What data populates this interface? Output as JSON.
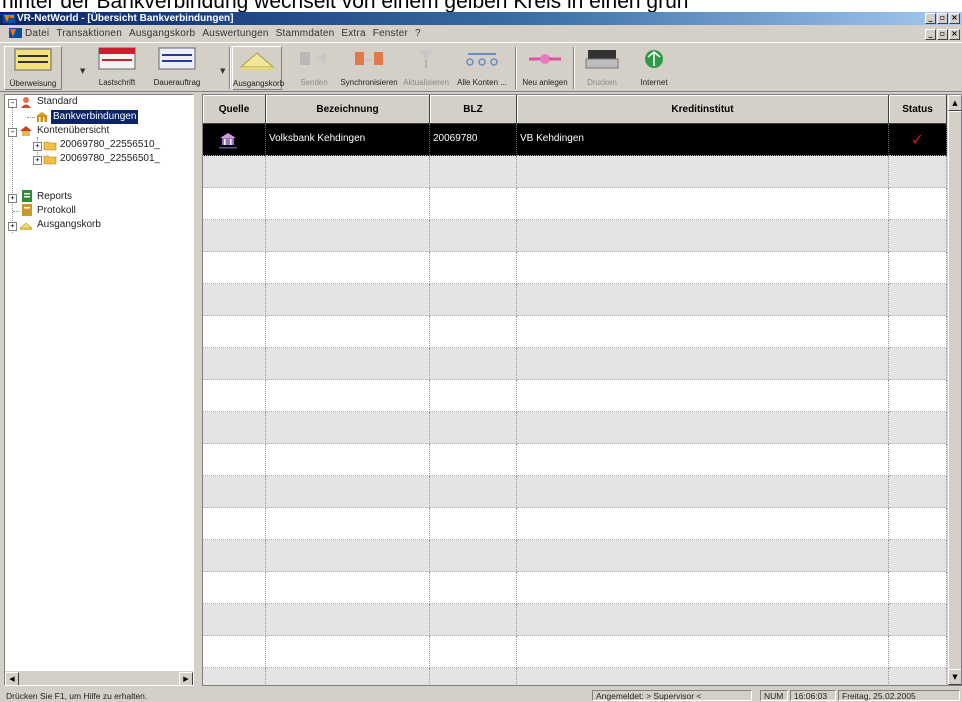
{
  "caption_text": "hinter der Bankverbindung wechselt von einem gelben Kreis in einen grün",
  "window": {
    "title": "VR-NetWorld - [Übersicht Bankverbindungen]"
  },
  "menu": [
    "Datei",
    "Transaktionen",
    "Ausgangskorb",
    "Auswertungen",
    "Stammdaten",
    "Extra",
    "Fenster",
    "?"
  ],
  "toolbar": [
    {
      "label": "Überweisung",
      "icon": "transfer-form-icon",
      "enabled": true
    },
    {
      "label": "Lastschrift",
      "icon": "debit-form-icon",
      "enabled": true
    },
    {
      "label": "Dauerauftrag",
      "icon": "standing-order-icon",
      "enabled": true
    },
    {
      "label": "Ausgangskorb",
      "icon": "outbox-icon",
      "enabled": true
    },
    {
      "label": "Senden",
      "icon": "send-icon",
      "enabled": false
    },
    {
      "label": "Synchronisieren",
      "icon": "synchronize-icon",
      "enabled": true
    },
    {
      "label": "Aktualisieren",
      "icon": "refresh-icon",
      "enabled": false
    },
    {
      "label": "Alle Konten ...",
      "icon": "all-accounts-icon",
      "enabled": true
    },
    {
      "label": "Neu anlegen",
      "icon": "new-create-icon",
      "enabled": true
    },
    {
      "label": "Drucken",
      "icon": "printer-icon",
      "enabled": false
    },
    {
      "label": "Internet",
      "icon": "internet-icon",
      "enabled": true
    }
  ],
  "tree": {
    "root": "Standard",
    "bank_connections": "Bankverbindungen",
    "account_overview": "Kontenübersicht",
    "account1": "20069780_22556510_",
    "account2": "20069780_22556501_",
    "reports": "Reports",
    "protocol": "Protokoll",
    "outbox": "Ausgangskorb"
  },
  "grid": {
    "columns": [
      "Quelle",
      "Bezeichnung",
      "BLZ",
      "Kreditinstitut",
      "Status"
    ],
    "rows": [
      {
        "quelle": "bank-logo-icon",
        "bezeichnung": "Volksbank Kehdingen",
        "blz": "20069780",
        "kreditinstitut": "VB Kehdingen",
        "status": "✓"
      }
    ]
  },
  "statusbar": {
    "help": "Drücken Sie F1, um Hilfe zu erhalten.",
    "login": "Angemeldet: > Supervisor <",
    "numlock": "NUM",
    "time": "16:06:03",
    "date": "Freitag, 25.02.2005"
  },
  "colors": {
    "selection": "#0a246a",
    "row_selected": "#000000",
    "status_check": "#c21d1d",
    "chrome": "#d4d0c8"
  }
}
